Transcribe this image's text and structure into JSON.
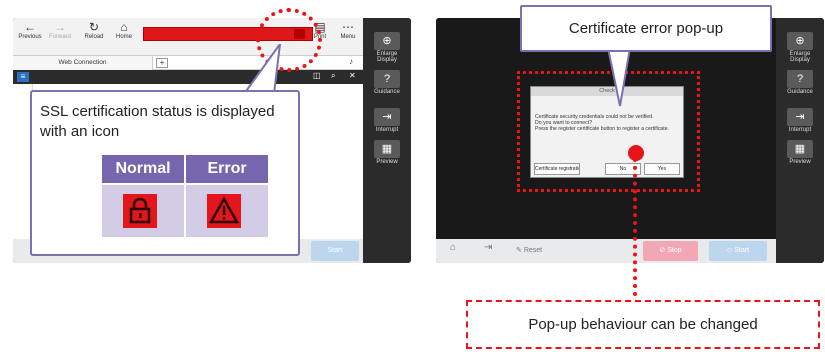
{
  "left_panel": {
    "toolbar": {
      "previous": "Previous",
      "forward": "Forward",
      "reload": "Reload",
      "home": "Home",
      "print": "Print",
      "menu": "Menu"
    },
    "tab_label": "Web Connection",
    "new_tab": "+",
    "side_buttons": {
      "enlarge": "Enlarge Display",
      "guidance": "Guidance",
      "interrupt": "Interrupt",
      "preview": "Preview"
    },
    "start_label": "Start"
  },
  "ssl_callout": {
    "text": "SSL certification status is displayed with an icon",
    "normal_label": "Normal",
    "error_label": "Error",
    "normal_icon": "lock-icon",
    "error_icon": "warning-icon",
    "icon_color": "#e2161b",
    "header_color": "#7666ad",
    "cell_color": "#d2cce4"
  },
  "right_panel": {
    "dialog": {
      "title": "Check",
      "message_line1": "Certificate security credentials could not be verified.",
      "message_line2": "Do you want to connect?",
      "message_line3": "Press the register certificate button to register a certificate.",
      "register_button": "Certificate registratio",
      "no_button": "No",
      "yes_button": "Yes"
    },
    "side_buttons": {
      "enlarge": "Enlarge Display",
      "guidance": "Guidance",
      "interrupt": "Interrupt",
      "preview": "Preview"
    },
    "bottom": {
      "reset": "Reset",
      "stop": "Stop",
      "start": "Start"
    }
  },
  "annotations": {
    "cert_popup": "Certificate error pop-up",
    "behaviour": "Pop-up behaviour can be changed",
    "highlight_color": "#e8141a"
  }
}
